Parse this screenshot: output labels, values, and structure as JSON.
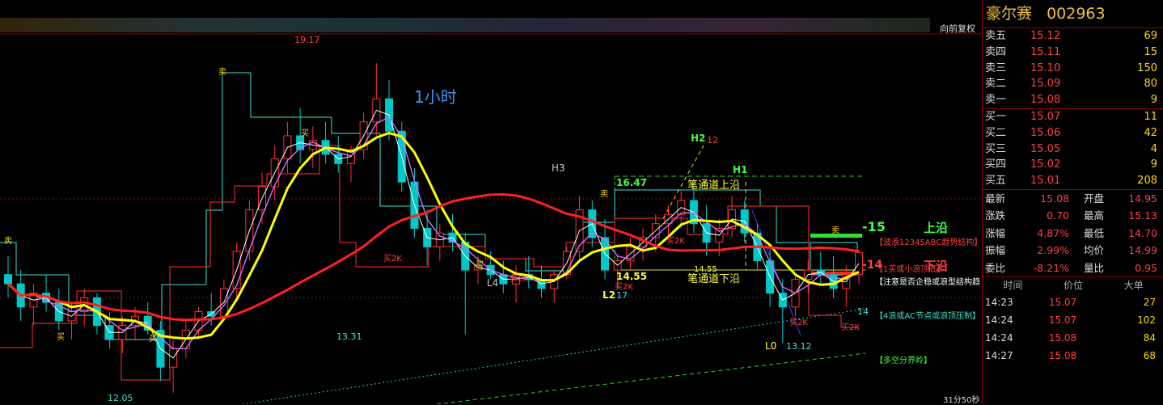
{
  "chart": {
    "period_label": "1小时",
    "restore_label": "向前复权",
    "countdown": "31分50秒",
    "price_labels": {
      "high": "19.17",
      "low_left": "12.05",
      "low_mid": "13.31",
      "low_right": "13.12",
      "h2_val": "12",
      "l2_val": "17",
      "level_1647": "16.47",
      "level_1455": "14.55",
      "level_1455b": "14.55",
      "right_14": "14"
    },
    "wave_labels": {
      "h3": "H3",
      "h2": "H2",
      "h1": "H1",
      "l4": "L4",
      "l2": "L2",
      "l0": "L0"
    },
    "annotations": {
      "upper_edge_num": "-15",
      "upper_edge": "上沿",
      "lower_edge_num": "-14",
      "lower_edge": "下沿",
      "channel_upper": "笔通道上沿",
      "channel_lower": "笔通道下沿",
      "note_wave": "【波浪12345ABC趋势结构】",
      "note_buy": "【1买或小浪顶底】",
      "note_attention": "【注意是否企稳或浪型结构趋",
      "note_ac": "【4浪或AC节点或浪顶压制】",
      "note_bull_bear": "【多空分界岭】"
    },
    "signals": {
      "buy2k": "买2K",
      "sell": "卖",
      "buy": "买"
    },
    "chart_data": {
      "type": "candlestick",
      "timeframe": "1小时",
      "ylim": [
        11.8,
        19.8
      ],
      "candles_ohlc": [
        [
          14.6,
          15.0,
          14.1,
          14.4
        ],
        [
          14.4,
          14.7,
          13.6,
          13.9
        ],
        [
          13.9,
          14.4,
          13.5,
          14.2
        ],
        [
          14.2,
          14.6,
          13.8,
          14.0
        ],
        [
          14.0,
          14.3,
          13.4,
          13.6
        ],
        [
          13.6,
          14.0,
          13.2,
          13.8
        ],
        [
          13.8,
          14.3,
          13.5,
          14.1
        ],
        [
          14.1,
          14.2,
          13.3,
          13.5
        ],
        [
          13.5,
          13.8,
          13.0,
          13.2
        ],
        [
          13.2,
          13.7,
          12.9,
          13.5
        ],
        [
          13.5,
          13.9,
          13.2,
          13.7
        ],
        [
          13.7,
          14.0,
          13.3,
          13.4
        ],
        [
          13.4,
          13.6,
          12.3,
          12.6
        ],
        [
          12.6,
          13.2,
          12.05,
          13.0
        ],
        [
          13.0,
          13.6,
          12.8,
          13.4
        ],
        [
          13.4,
          13.9,
          13.2,
          13.8
        ],
        [
          13.8,
          14.2,
          13.5,
          13.7
        ],
        [
          13.7,
          14.5,
          13.6,
          14.3
        ],
        [
          14.3,
          15.3,
          14.1,
          15.1
        ],
        [
          15.1,
          16.2,
          14.9,
          16.0
        ],
        [
          16.0,
          16.8,
          15.7,
          16.5
        ],
        [
          16.5,
          17.4,
          16.2,
          17.1
        ],
        [
          17.1,
          17.9,
          16.8,
          17.6
        ],
        [
          17.6,
          18.2,
          17.0,
          17.3
        ],
        [
          17.3,
          17.8,
          16.9,
          17.5
        ],
        [
          17.5,
          17.9,
          17.0,
          17.2
        ],
        [
          17.2,
          17.6,
          16.8,
          17.0
        ],
        [
          17.0,
          17.4,
          16.6,
          17.3
        ],
        [
          17.3,
          18.1,
          17.1,
          17.9
        ],
        [
          17.9,
          19.17,
          17.6,
          18.4
        ],
        [
          18.4,
          18.8,
          17.5,
          17.7
        ],
        [
          17.7,
          17.9,
          16.4,
          16.6
        ],
        [
          16.6,
          16.9,
          15.4,
          15.6
        ],
        [
          15.6,
          16.0,
          14.8,
          15.2
        ],
        [
          15.2,
          15.7,
          14.9,
          15.5
        ],
        [
          15.5,
          15.9,
          15.1,
          15.3
        ],
        [
          15.3,
          15.5,
          13.31,
          14.7
        ],
        [
          14.7,
          15.0,
          14.4,
          14.8
        ],
        [
          14.8,
          15.1,
          14.5,
          14.6
        ],
        [
          14.6,
          14.9,
          14.2,
          14.4
        ],
        [
          14.4,
          14.8,
          14.0,
          14.6
        ],
        [
          14.6,
          15.0,
          14.3,
          14.5
        ],
        [
          14.5,
          14.8,
          14.1,
          14.3
        ],
        [
          14.3,
          14.7,
          14.0,
          14.6
        ],
        [
          14.6,
          15.2,
          14.5,
          15.1
        ],
        [
          15.1,
          16.3,
          14.9,
          16.0
        ],
        [
          16.0,
          16.2,
          15.2,
          15.4
        ],
        [
          15.4,
          15.8,
          14.5,
          14.7
        ],
        [
          14.7,
          15.0,
          14.3,
          14.9
        ],
        [
          14.9,
          15.4,
          14.7,
          15.2
        ],
        [
          15.2,
          15.6,
          14.9,
          15.4
        ],
        [
          15.4,
          15.9,
          15.1,
          15.7
        ],
        [
          15.7,
          16.1,
          15.4,
          15.9
        ],
        [
          15.9,
          16.4,
          15.6,
          16.2
        ],
        [
          16.2,
          16.6,
          15.5,
          15.7
        ],
        [
          15.7,
          16.1,
          15.0,
          15.3
        ],
        [
          15.3,
          15.8,
          15.0,
          15.6
        ],
        [
          15.6,
          16.3,
          15.4,
          16.0
        ],
        [
          16.0,
          16.2,
          15.3,
          15.5
        ],
        [
          15.5,
          15.7,
          14.7,
          14.9
        ],
        [
          14.9,
          15.2,
          13.9,
          14.2
        ],
        [
          14.2,
          14.5,
          13.12,
          13.9
        ],
        [
          13.9,
          14.6,
          13.7,
          14.5
        ],
        [
          14.5,
          14.9,
          14.2,
          14.7
        ],
        [
          14.7,
          15.1,
          14.4,
          14.6
        ],
        [
          14.6,
          15.0,
          14.1,
          14.3
        ],
        [
          14.3,
          14.8,
          13.9,
          14.6
        ],
        [
          14.6,
          15.13,
          14.4,
          15.08
        ]
      ]
    }
  },
  "stock": {
    "name": "豪尔赛",
    "code": "002963"
  },
  "order_book": [
    {
      "label": "卖五",
      "price": "15.12",
      "vol": "69"
    },
    {
      "label": "卖四",
      "price": "15.11",
      "vol": "15"
    },
    {
      "label": "卖三",
      "price": "15.10",
      "vol": "150"
    },
    {
      "label": "卖二",
      "price": "15.09",
      "vol": "80"
    },
    {
      "label": "卖一",
      "price": "15.08",
      "vol": "9"
    },
    {
      "label": "买一",
      "price": "15.07",
      "vol": "11"
    },
    {
      "label": "买二",
      "price": "15.06",
      "vol": "42"
    },
    {
      "label": "买三",
      "price": "15.05",
      "vol": "4"
    },
    {
      "label": "买四",
      "price": "15.02",
      "vol": "9"
    },
    {
      "label": "买五",
      "price": "15.01",
      "vol": "208"
    }
  ],
  "stats": [
    {
      "k": "最新",
      "v": "15.08",
      "k2": "开盘",
      "v2": "14.95"
    },
    {
      "k": "涨跌",
      "v": "0.70",
      "k2": "最高",
      "v2": "15.13"
    },
    {
      "k": "涨幅",
      "v": "4.87%",
      "k2": "最低",
      "v2": "14.70"
    },
    {
      "k": "振幅",
      "v": "2.99%",
      "k2": "均价",
      "v2": "14.99"
    },
    {
      "k": "委比",
      "v": "-8.21%",
      "k2": "量比",
      "v2": "0.95"
    }
  ],
  "ticks_header": {
    "time": "时间",
    "price": "价位",
    "vol": "大单"
  },
  "ticks": [
    {
      "t": "14:23",
      "p": "15.07",
      "q": "27"
    },
    {
      "t": "14:24",
      "p": "15.07",
      "q": "102"
    },
    {
      "t": "14:24",
      "p": "15.08",
      "q": "84"
    },
    {
      "t": "14:27",
      "p": "15.08",
      "q": "68"
    }
  ],
  "colors": {
    "up": "#ff3030",
    "down": "#00c8c8",
    "ma_yellow": "#ffff00",
    "ma_red": "#ff2020",
    "ma_white": "#ffffff",
    "ma_purple": "#d070ff",
    "step_cyan": "#40e0d0",
    "step_red": "#ff3030",
    "accent_green": "#40ff40",
    "label_blue": "#3399ff"
  }
}
